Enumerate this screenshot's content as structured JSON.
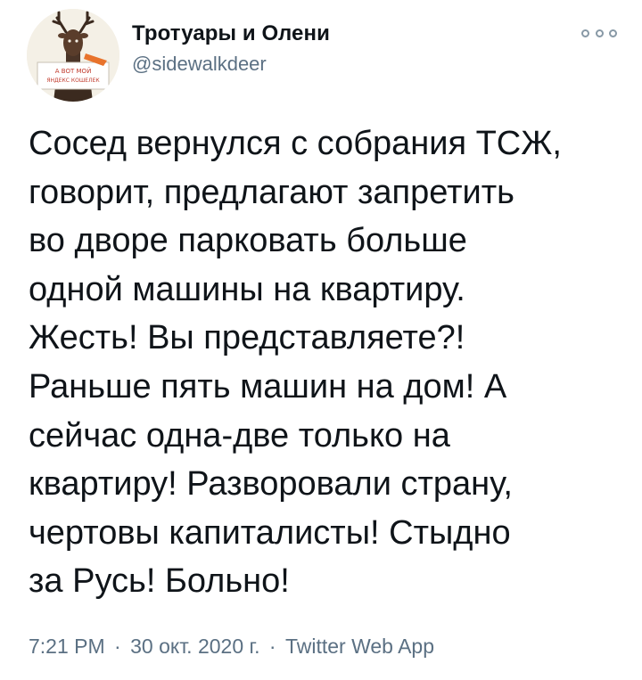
{
  "author": {
    "display_name": "Тротуары и Олени",
    "handle": "@sidewalkdeer",
    "avatar_icon": "deer-holding-sign-avatar",
    "avatar_sign_text": [
      "А ВОТ МОЙ",
      "ЯНДЕКС КОШЕЛЕК"
    ]
  },
  "more_icon": "more-options-icon",
  "tweet": {
    "lines": [
      "Сосед вернулся с собрания ТСЖ,",
      "говорит, предлагают запретить",
      "во дворе парковать больше",
      "одной машины на квартиру.",
      "Жесть! Вы представляете?!",
      "Раньше пять машин на дом! А",
      "сейчас одна-две только на",
      "квартиру! Разворовали страну,",
      "чертовы капиталисты! Стыдно",
      "за Русь! Больно!"
    ]
  },
  "meta": {
    "time": "7:21 PM",
    "separator": "·",
    "date": "30 окт. 2020 г.",
    "source": "Twitter Web App"
  },
  "colors": {
    "text": "#0f1419",
    "secondary": "#5b7083",
    "avatar_sign": "#e8732c"
  }
}
